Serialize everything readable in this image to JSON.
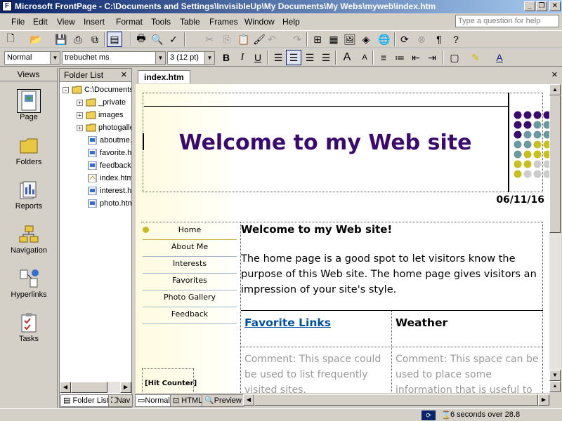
{
  "window": {
    "title": "Microsoft FrontPage - C:\\Documents and Settings\\InvisibleUp\\My Documents\\My Webs\\myweb\\index.htm",
    "minimize": "_",
    "restore": "❐",
    "close": "✕"
  },
  "menu": {
    "items": [
      "File",
      "Edit",
      "View",
      "Insert",
      "Format",
      "Tools",
      "Table",
      "Frames",
      "Window",
      "Help"
    ],
    "ask_placeholder": "Type a question for help",
    "close_doc": "✕"
  },
  "formatting": {
    "style": "Normal",
    "font": "trebuchet ms",
    "size": "3  (12 pt)"
  },
  "views": {
    "header": "Views",
    "items": [
      {
        "label": "Page",
        "icon": "page-view-icon"
      },
      {
        "label": "Folders",
        "icon": "folders-view-icon"
      },
      {
        "label": "Reports",
        "icon": "reports-view-icon"
      },
      {
        "label": "Navigation",
        "icon": "navigation-view-icon"
      },
      {
        "label": "Hyperlinks",
        "icon": "hyperlinks-view-icon"
      },
      {
        "label": "Tasks",
        "icon": "tasks-view-icon"
      }
    ]
  },
  "folderlist": {
    "header": "Folder List",
    "close": "✕",
    "root": "C:\\Documents and Settings\\InvisibleUp\\My Documents\\My Webs\\myweb",
    "folders": [
      "_private",
      "images",
      "photogallery"
    ],
    "files": [
      "aboutme.htm",
      "favorite.htm",
      "feedback.htm",
      "index.htm",
      "interest.htm",
      "photo.htm"
    ]
  },
  "document": {
    "tab": "index.htm",
    "banner": "Welcome to my Web site",
    "date": "06/11/16",
    "nav": [
      "Home",
      "About Me",
      "Interests",
      "Favorites",
      "Photo Gallery",
      "Feedback"
    ],
    "hit_counter": "[Hit Counter]",
    "heading": "Welcome to my Web site!",
    "intro": "The home page is a good spot to let visitors know the purpose of this Web site. The home page gives visitors an impression of your site's style.",
    "col1_title": "Favorite Links",
    "col2_title": "Weather",
    "col1_comment": "Comment: This space could be used to list frequently visited sites.",
    "col2_comment": "Comment: This space can be used to place some information that is useful to",
    "colors": {
      "banner": "#3b0a6e",
      "link": "#0050a0",
      "comment": "#999999"
    }
  },
  "bottom_tabs": {
    "folder_list": "Folder List",
    "navigation": "Nav",
    "normal": "Normal",
    "html": "HTML",
    "preview": "Preview"
  },
  "status": {
    "download_time": "6 seconds over 28.8"
  }
}
